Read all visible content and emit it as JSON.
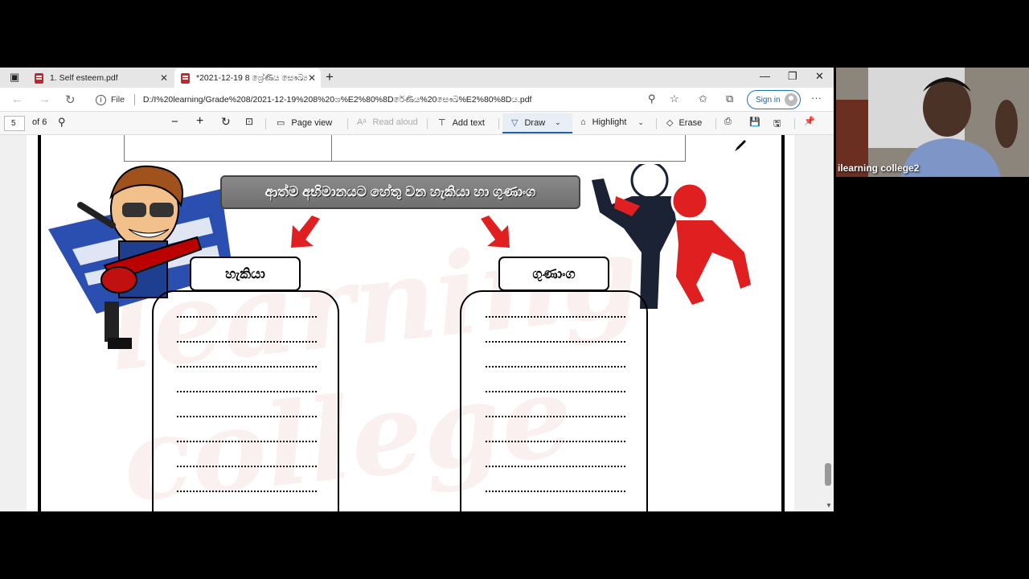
{
  "browser": {
    "tabs": [
      {
        "title": "1. Self esteem.pdf",
        "active": false
      },
      {
        "title": "*2021-12-19 8 ශ්‍රේණිය සෞඛ්‍ය",
        "active": true
      }
    ],
    "new_tab_symbol": "+",
    "address": {
      "scheme_label": "File",
      "url": "D:/I%20learning/Grade%208/2021-12-19%208%20ශ%E2%80%8Dරේණිය%20සෞඛ%E2%80%8Dය.pdf"
    },
    "signin_label": "Sign in"
  },
  "pdf_toolbar": {
    "page_number": "5",
    "page_total": "of 6",
    "page_view_label": "Page view",
    "read_aloud_label": "Read aloud",
    "add_text_label": "Add text",
    "draw_label": "Draw",
    "highlight_label": "Highlight",
    "erase_label": "Erase"
  },
  "document": {
    "banner_title": "ආත්ම අභිමානයට හේතු වන හැකියා හා ගුණාංග",
    "left_box_label": "හැකියා",
    "right_box_label": "ගුණාංග",
    "dotted_lines_per_box": 8,
    "watermark_text": "learning college"
  },
  "webcam": {
    "participant_name": "ilearning college2"
  },
  "colors": {
    "accent": "#1a5fb0",
    "arrow_red": "#e02020",
    "banner_gray": "#7a7a7a"
  }
}
